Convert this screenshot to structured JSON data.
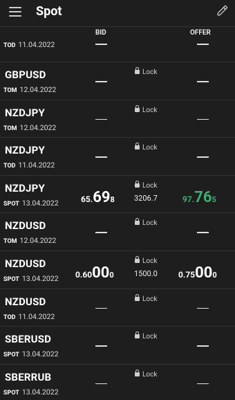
{
  "header": {
    "title": "Spot"
  },
  "columns": {
    "bid": "BID",
    "offer": "OFFER"
  },
  "lock_label": "Lock",
  "rows": [
    {
      "symbol": "",
      "tenor": "TOD",
      "date": "11.04.2022"
    },
    {
      "symbol": "GBPUSD",
      "tenor": "TOM",
      "date": "12.04.2022"
    },
    {
      "symbol": "NZDJPY",
      "tenor": "TOM",
      "date": "12.04.2022"
    },
    {
      "symbol": "NZDJPY",
      "tenor": "TOD",
      "date": "11.04.2022"
    },
    {
      "symbol": "NZDJPY",
      "tenor": "SPOT",
      "date": "13.04.2022",
      "spread": "3206.7",
      "bid": {
        "pre": "65.",
        "big": "69",
        "pip": "8"
      },
      "offer": {
        "pre": "97.",
        "big": "76",
        "pip": "5"
      }
    },
    {
      "symbol": "NZDUSD",
      "tenor": "TOM",
      "date": "12.04.2022"
    },
    {
      "symbol": "NZDUSD",
      "tenor": "SPOT",
      "date": "13.04.2022",
      "spread": "1500.0",
      "bid": {
        "pre": "0.60",
        "big": "00",
        "pip": "0"
      },
      "offer": {
        "pre": "0.75",
        "big": "00",
        "pip": "0"
      }
    },
    {
      "symbol": "NZDUSD",
      "tenor": "TOD",
      "date": "11.04.2022"
    },
    {
      "symbol": "SBERUSD",
      "tenor": "SPOT",
      "date": "13.04.2022"
    },
    {
      "symbol": "SBERRUB",
      "tenor": "SPOT",
      "date": "13.04.2022"
    }
  ],
  "colors": {
    "accent_green": "#3fae72",
    "background": "#1e1e1e"
  }
}
